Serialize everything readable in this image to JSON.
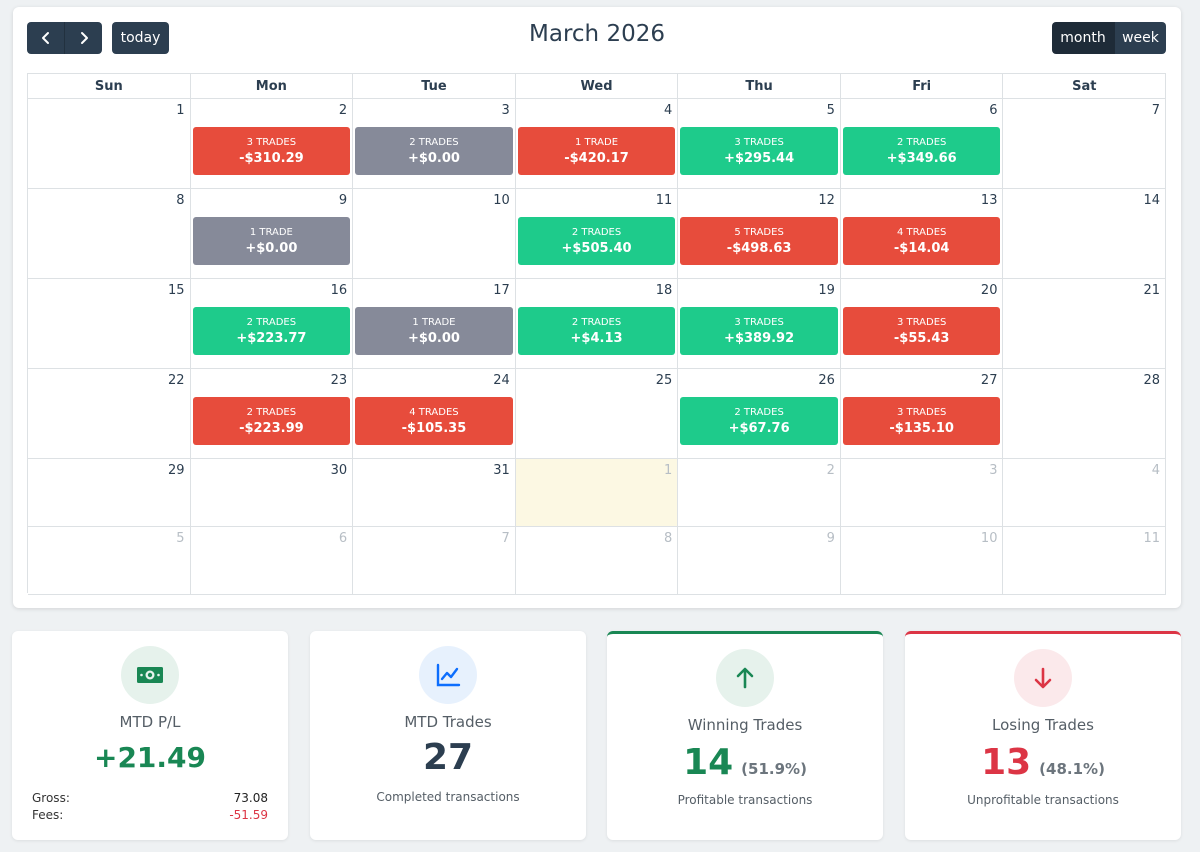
{
  "calendar": {
    "title": "March 2026",
    "today_label": "today",
    "prev_icon": "chevron-left-icon",
    "next_icon": "chevron-right-icon",
    "views": {
      "month": "month",
      "week": "week"
    },
    "weekdays": [
      "Sun",
      "Mon",
      "Tue",
      "Wed",
      "Thu",
      "Fri",
      "Sat"
    ],
    "colors": {
      "loss": "#e74c3c",
      "win": "#1ecb8b",
      "flat": "#868a99",
      "today_bg": "#fcf8e3"
    },
    "weeks": [
      [
        {
          "day": "1",
          "other": false
        },
        {
          "day": "2",
          "other": false,
          "event": {
            "trades": "3 trades",
            "pl": "-$310.29",
            "kind": "loss"
          }
        },
        {
          "day": "3",
          "other": false,
          "event": {
            "trades": "2 trades",
            "pl": "+$0.00",
            "kind": "flat"
          }
        },
        {
          "day": "4",
          "other": false,
          "event": {
            "trades": "1 trade",
            "pl": "-$420.17",
            "kind": "loss"
          }
        },
        {
          "day": "5",
          "other": false,
          "event": {
            "trades": "3 trades",
            "pl": "+$295.44",
            "kind": "win"
          }
        },
        {
          "day": "6",
          "other": false,
          "event": {
            "trades": "2 trades",
            "pl": "+$349.66",
            "kind": "win"
          }
        },
        {
          "day": "7",
          "other": false
        }
      ],
      [
        {
          "day": "8",
          "other": false
        },
        {
          "day": "9",
          "other": false,
          "event": {
            "trades": "1 trade",
            "pl": "+$0.00",
            "kind": "flat"
          }
        },
        {
          "day": "10",
          "other": false
        },
        {
          "day": "11",
          "other": false,
          "event": {
            "trades": "2 trades",
            "pl": "+$505.40",
            "kind": "win"
          }
        },
        {
          "day": "12",
          "other": false,
          "event": {
            "trades": "5 trades",
            "pl": "-$498.63",
            "kind": "loss"
          }
        },
        {
          "day": "13",
          "other": false,
          "event": {
            "trades": "4 trades",
            "pl": "-$14.04",
            "kind": "loss"
          }
        },
        {
          "day": "14",
          "other": false
        }
      ],
      [
        {
          "day": "15",
          "other": false
        },
        {
          "day": "16",
          "other": false,
          "event": {
            "trades": "2 trades",
            "pl": "+$223.77",
            "kind": "win"
          }
        },
        {
          "day": "17",
          "other": false,
          "event": {
            "trades": "1 trade",
            "pl": "+$0.00",
            "kind": "flat"
          }
        },
        {
          "day": "18",
          "other": false,
          "event": {
            "trades": "2 trades",
            "pl": "+$4.13",
            "kind": "win"
          }
        },
        {
          "day": "19",
          "other": false,
          "event": {
            "trades": "3 trades",
            "pl": "+$389.92",
            "kind": "win"
          }
        },
        {
          "day": "20",
          "other": false,
          "event": {
            "trades": "3 trades",
            "pl": "-$55.43",
            "kind": "loss"
          }
        },
        {
          "day": "21",
          "other": false
        }
      ],
      [
        {
          "day": "22",
          "other": false
        },
        {
          "day": "23",
          "other": false,
          "event": {
            "trades": "2 trades",
            "pl": "-$223.99",
            "kind": "loss"
          }
        },
        {
          "day": "24",
          "other": false,
          "event": {
            "trades": "4 trades",
            "pl": "-$105.35",
            "kind": "loss"
          }
        },
        {
          "day": "25",
          "other": false
        },
        {
          "day": "26",
          "other": false,
          "event": {
            "trades": "2 trades",
            "pl": "+$67.76",
            "kind": "win"
          }
        },
        {
          "day": "27",
          "other": false,
          "event": {
            "trades": "3 trades",
            "pl": "-$135.10",
            "kind": "loss"
          }
        },
        {
          "day": "28",
          "other": false
        }
      ],
      [
        {
          "day": "29",
          "other": false
        },
        {
          "day": "30",
          "other": false
        },
        {
          "day": "31",
          "other": false
        },
        {
          "day": "1",
          "other": true,
          "today": true
        },
        {
          "day": "2",
          "other": true
        },
        {
          "day": "3",
          "other": true
        },
        {
          "day": "4",
          "other": true
        }
      ],
      [
        {
          "day": "5",
          "other": true
        },
        {
          "day": "6",
          "other": true
        },
        {
          "day": "7",
          "other": true
        },
        {
          "day": "8",
          "other": true
        },
        {
          "day": "9",
          "other": true
        },
        {
          "day": "10",
          "other": true
        },
        {
          "day": "11",
          "other": true
        }
      ]
    ]
  },
  "stats": {
    "pl": {
      "icon": "money-bill-icon",
      "label": "MTD P/L",
      "value": "+21.49",
      "value_color": "#198754",
      "gross_label": "Gross:",
      "gross_value": "73.08",
      "fees_label": "Fees:",
      "fees_value": "-51.59",
      "fees_color": "#dc3545"
    },
    "trades": {
      "icon": "chart-line-icon",
      "label": "MTD Trades",
      "value": "27",
      "sub": "Completed transactions"
    },
    "winning": {
      "icon": "arrow-up-icon",
      "label": "Winning Trades",
      "value": "14",
      "pct": "(51.9%)",
      "sub": "Profitable transactions",
      "color": "#198754"
    },
    "losing": {
      "icon": "arrow-down-icon",
      "label": "Losing Trades",
      "value": "13",
      "pct": "(48.1%)",
      "sub": "Unprofitable transactions",
      "color": "#dc3545"
    }
  }
}
